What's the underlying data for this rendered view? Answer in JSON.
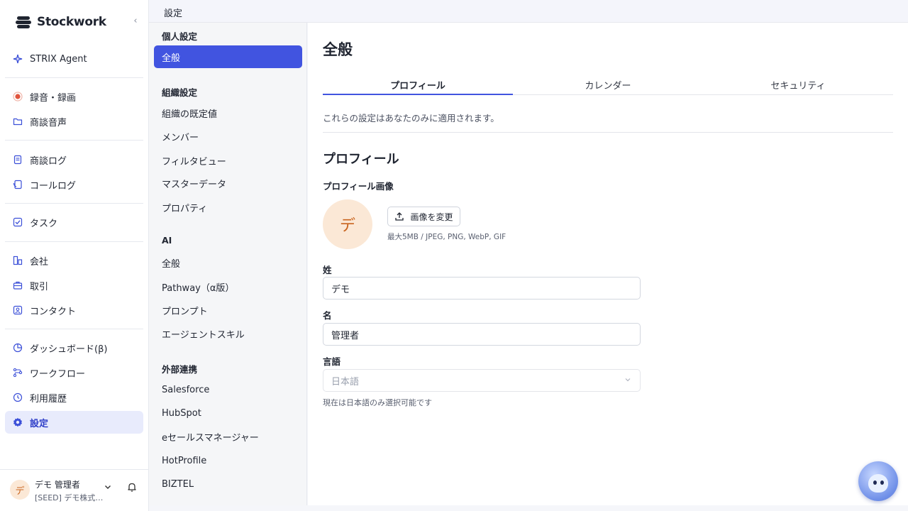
{
  "brand": {
    "name": "Stockwork"
  },
  "sidebar": {
    "groups": [
      [
        {
          "label": "STRIX Agent",
          "icon": "sparkle-icon"
        }
      ],
      [
        {
          "label": "録音・録画",
          "icon": "record-icon"
        },
        {
          "label": "商談音声",
          "icon": "folder-icon"
        }
      ],
      [
        {
          "label": "商談ログ",
          "icon": "document-icon"
        },
        {
          "label": "コールログ",
          "icon": "phone-log-icon"
        }
      ],
      [
        {
          "label": "タスク",
          "icon": "checkbox-icon"
        }
      ],
      [
        {
          "label": "会社",
          "icon": "building-icon"
        },
        {
          "label": "取引",
          "icon": "briefcase-icon"
        },
        {
          "label": "コンタクト",
          "icon": "contact-icon"
        }
      ],
      [
        {
          "label": "ダッシュボード(β)",
          "icon": "pie-chart-icon"
        },
        {
          "label": "ワークフロー",
          "icon": "workflow-icon"
        },
        {
          "label": "利用履歴",
          "icon": "history-icon"
        },
        {
          "label": "設定",
          "icon": "gear-icon",
          "active": true
        }
      ]
    ],
    "user": {
      "initial": "デ",
      "name": "デモ 管理者",
      "org": "[SEED] デモ株式…"
    }
  },
  "topbar": {
    "breadcrumb": "設定"
  },
  "subnav": {
    "personal_heading": "個人設定",
    "personal_items": [
      "全般"
    ],
    "org_heading": "組織設定",
    "org_items": [
      "組織の既定値",
      "メンバー",
      "フィルタビュー",
      "マスターデータ",
      "プロパティ"
    ],
    "ai_heading": "AI",
    "ai_items": [
      "全般",
      "Pathway（α版）",
      "プロンプト",
      "エージェントスキル"
    ],
    "ext_heading": "外部連携",
    "ext_items": [
      "Salesforce",
      "HubSpot",
      "eセールスマネージャー",
      "HotProfile",
      "BIZTEL"
    ]
  },
  "main": {
    "title": "全般",
    "tabs": [
      "プロフィール",
      "カレンダー",
      "セキュリティ"
    ],
    "active_tab": 0,
    "description": "これらの設定はあなたのみに適用されます。",
    "section_title": "プロフィール",
    "profile_image_label": "プロフィール画像",
    "avatar_initial": "デ",
    "upload_label": "画像を変更",
    "upload_hint": "最大5MB / JPEG, PNG, WebP, GIF",
    "last_name_label": "姓",
    "last_name_value": "デモ",
    "first_name_label": "名",
    "first_name_value": "管理者",
    "language_label": "言語",
    "language_value": "日本語",
    "language_helper": "現在は日本語のみ選択可能です"
  },
  "colors": {
    "accent": "#4154e0",
    "active_bg": "#e8ebfc",
    "avatar_bg": "#fbe8d6",
    "avatar_fg": "#c9641e"
  }
}
